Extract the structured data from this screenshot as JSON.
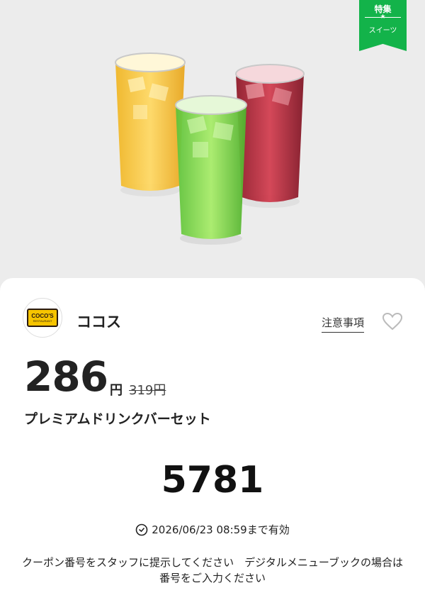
{
  "badge": {
    "line1": "特集",
    "star": "★",
    "line2": "スイーツ"
  },
  "store": {
    "logo_text": "COCO'S",
    "logo_subtext": "RESTAURANT",
    "name": "ココス"
  },
  "actions": {
    "notes_label": "注意事項",
    "favorite_icon": "heart-icon"
  },
  "offer": {
    "price": "286",
    "currency": "円",
    "original_price": "319円",
    "title": "プレミアムドリンクバーセット"
  },
  "coupon": {
    "code": "5781",
    "expiry": "2026/06/23 08:59まで有効",
    "instruction": "クーポン番号をスタッフに提示してください　デジタルメニューブックの場合は番号をご入力ください"
  },
  "colors": {
    "badge_green": "#13b34a",
    "logo_yellow": "#f6c400"
  }
}
